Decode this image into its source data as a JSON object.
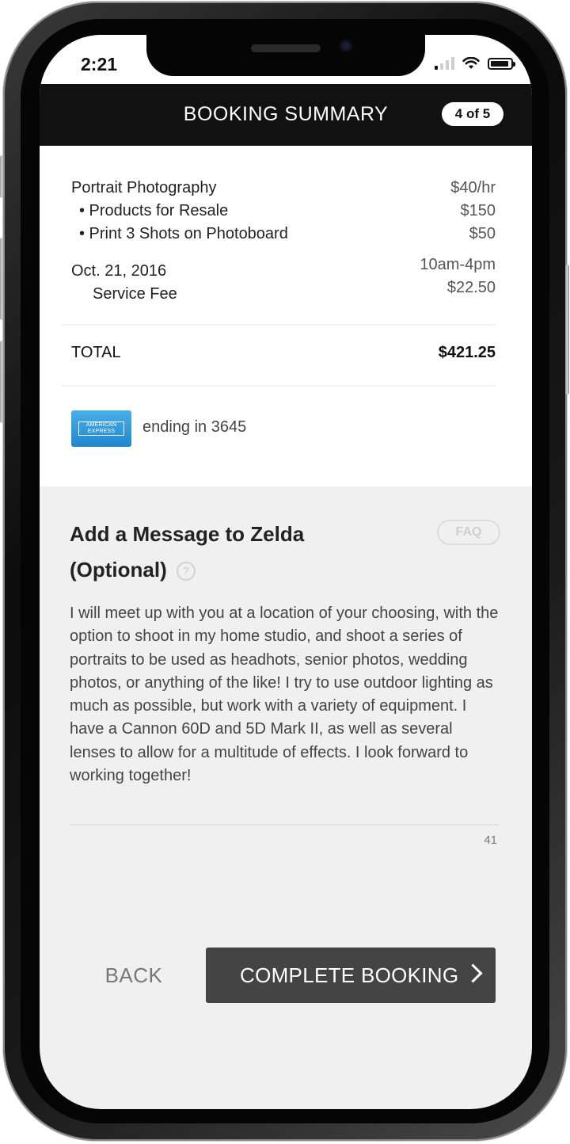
{
  "status_bar": {
    "time": "2:21",
    "icons": [
      "signal-icon",
      "wifi-icon",
      "battery-icon"
    ]
  },
  "header": {
    "title": "BOOKING SUMMARY",
    "step": "4 of 5"
  },
  "summary": {
    "service": {
      "label": "Portrait Photography",
      "price": "$40/hr"
    },
    "addons": [
      {
        "label": "• Products for Resale",
        "price": "$150"
      },
      {
        "label": "• Print 3 Shots on Photoboard",
        "price": "$50"
      }
    ],
    "date": "Oct. 21, 2016",
    "time_range": "10am-4pm",
    "service_fee": {
      "label": "Service Fee",
      "price": "$22.50"
    },
    "total": {
      "label": "TOTAL",
      "value": "$421.25"
    },
    "payment": {
      "card_brand_text": "AMERICAN EXPRESS",
      "card_text": "ending in 3645",
      "card_color": "#2a93d8"
    }
  },
  "message": {
    "title": "Add a Message to Zelda (Optional)",
    "help_icon": "?",
    "faq_label": "FAQ",
    "body": "I will meet up with you at a location of your choosing, with the option to shoot in my home studio, and shoot a series of portraits to be used as headhots, senior photos, wedding photos, or anything of the like! I try to use outdoor lighting as much as possible, but work with a variety of equipment. I have a Cannon 60D and 5D Mark II, as well as several lenses to allow for a multitude of effects. I look forward to working together!",
    "char_count": "41"
  },
  "actions": {
    "back_label": "BACK",
    "complete_label": "COMPLETE BOOKING",
    "complete_color": "#444444"
  },
  "battery_level": 0.9
}
